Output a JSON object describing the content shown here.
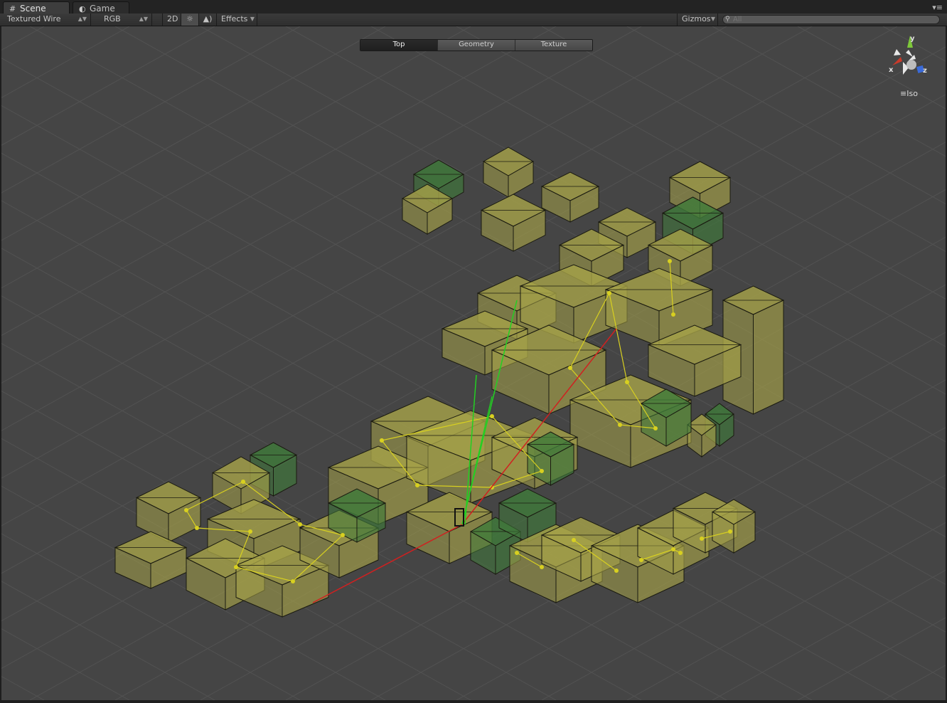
{
  "tabs": [
    {
      "label": "Scene",
      "icon": "grid-icon",
      "active": true
    },
    {
      "label": "Game",
      "icon": "pacman-icon",
      "active": false
    }
  ],
  "toolbar": {
    "draw_mode": "Textured Wire",
    "render_mode": "RGB",
    "toggle_2d": "2D",
    "lighting_icon": "sun-icon",
    "audio_icon": "speaker-icon",
    "effects": "Effects",
    "gizmos": "Gizmos",
    "search_placeholder": "All"
  },
  "overlay": {
    "segments": [
      "Top",
      "Geometry",
      "Texture"
    ],
    "selected": "Top"
  },
  "orientation_gizmo": {
    "axes": {
      "x": "x",
      "y": "y",
      "z": "z"
    },
    "projection": "Iso",
    "colors": {
      "x": "#c83a2a",
      "y": "#7ec83a",
      "z": "#3a6ad8"
    }
  },
  "colors": {
    "scene_bg": "#454545",
    "box_fill": "#a6a248",
    "box_fill_green": "#3f7a3a",
    "waypoint": "#d8d020",
    "axis_red": "#d02020",
    "axis_green": "#22d022"
  }
}
